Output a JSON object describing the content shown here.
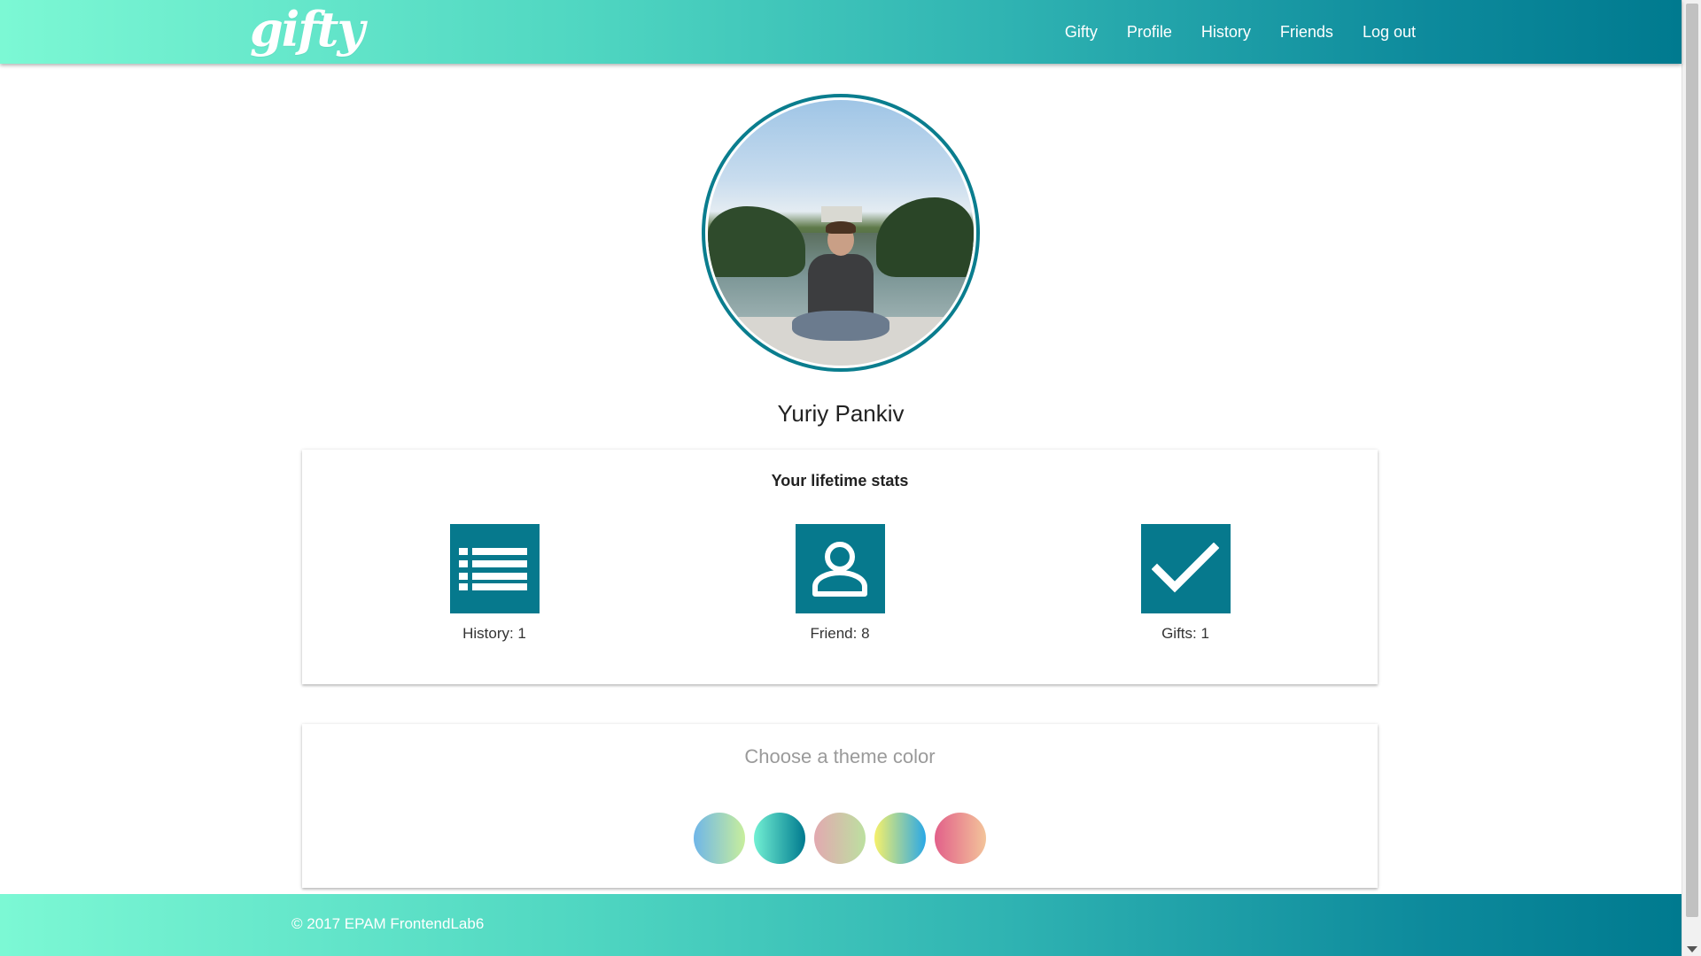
{
  "header": {
    "logo": "gifty",
    "nav": [
      "Gifty",
      "Profile",
      "History",
      "Friends",
      "Log out"
    ]
  },
  "profile": {
    "name": "Yuriy Pankiv",
    "avatar_alt": "profile photo"
  },
  "stats": {
    "title": "Your lifetime stats",
    "items": [
      {
        "label": "History: 1",
        "icon": "list-icon"
      },
      {
        "label": "Friend: 8",
        "icon": "person-icon"
      },
      {
        "label": "Gifts: 1",
        "icon": "checkmark-icon"
      }
    ],
    "icon_color": "#06798d"
  },
  "theme": {
    "title": "Choose a theme color",
    "swatches": [
      {
        "name": "blue-green",
        "from": "#6fb6e8",
        "to": "#c8ee9c"
      },
      {
        "name": "teal",
        "from": "#72f0d3",
        "to": "#007a8f"
      },
      {
        "name": "rose-green",
        "from": "#e2a9b0",
        "to": "#bce0a0"
      },
      {
        "name": "yellow-blue",
        "from": "#f6f06a",
        "to": "#2aa8e6"
      },
      {
        "name": "pink-peach",
        "from": "#e2608a",
        "to": "#f3c49a"
      }
    ]
  },
  "footer": {
    "text": "© 2017 EPAM FrontendLab6"
  },
  "colors": {
    "header_gradient_start": "#7cf8d4",
    "header_gradient_end": "#007a8f",
    "accent": "#06798d"
  }
}
